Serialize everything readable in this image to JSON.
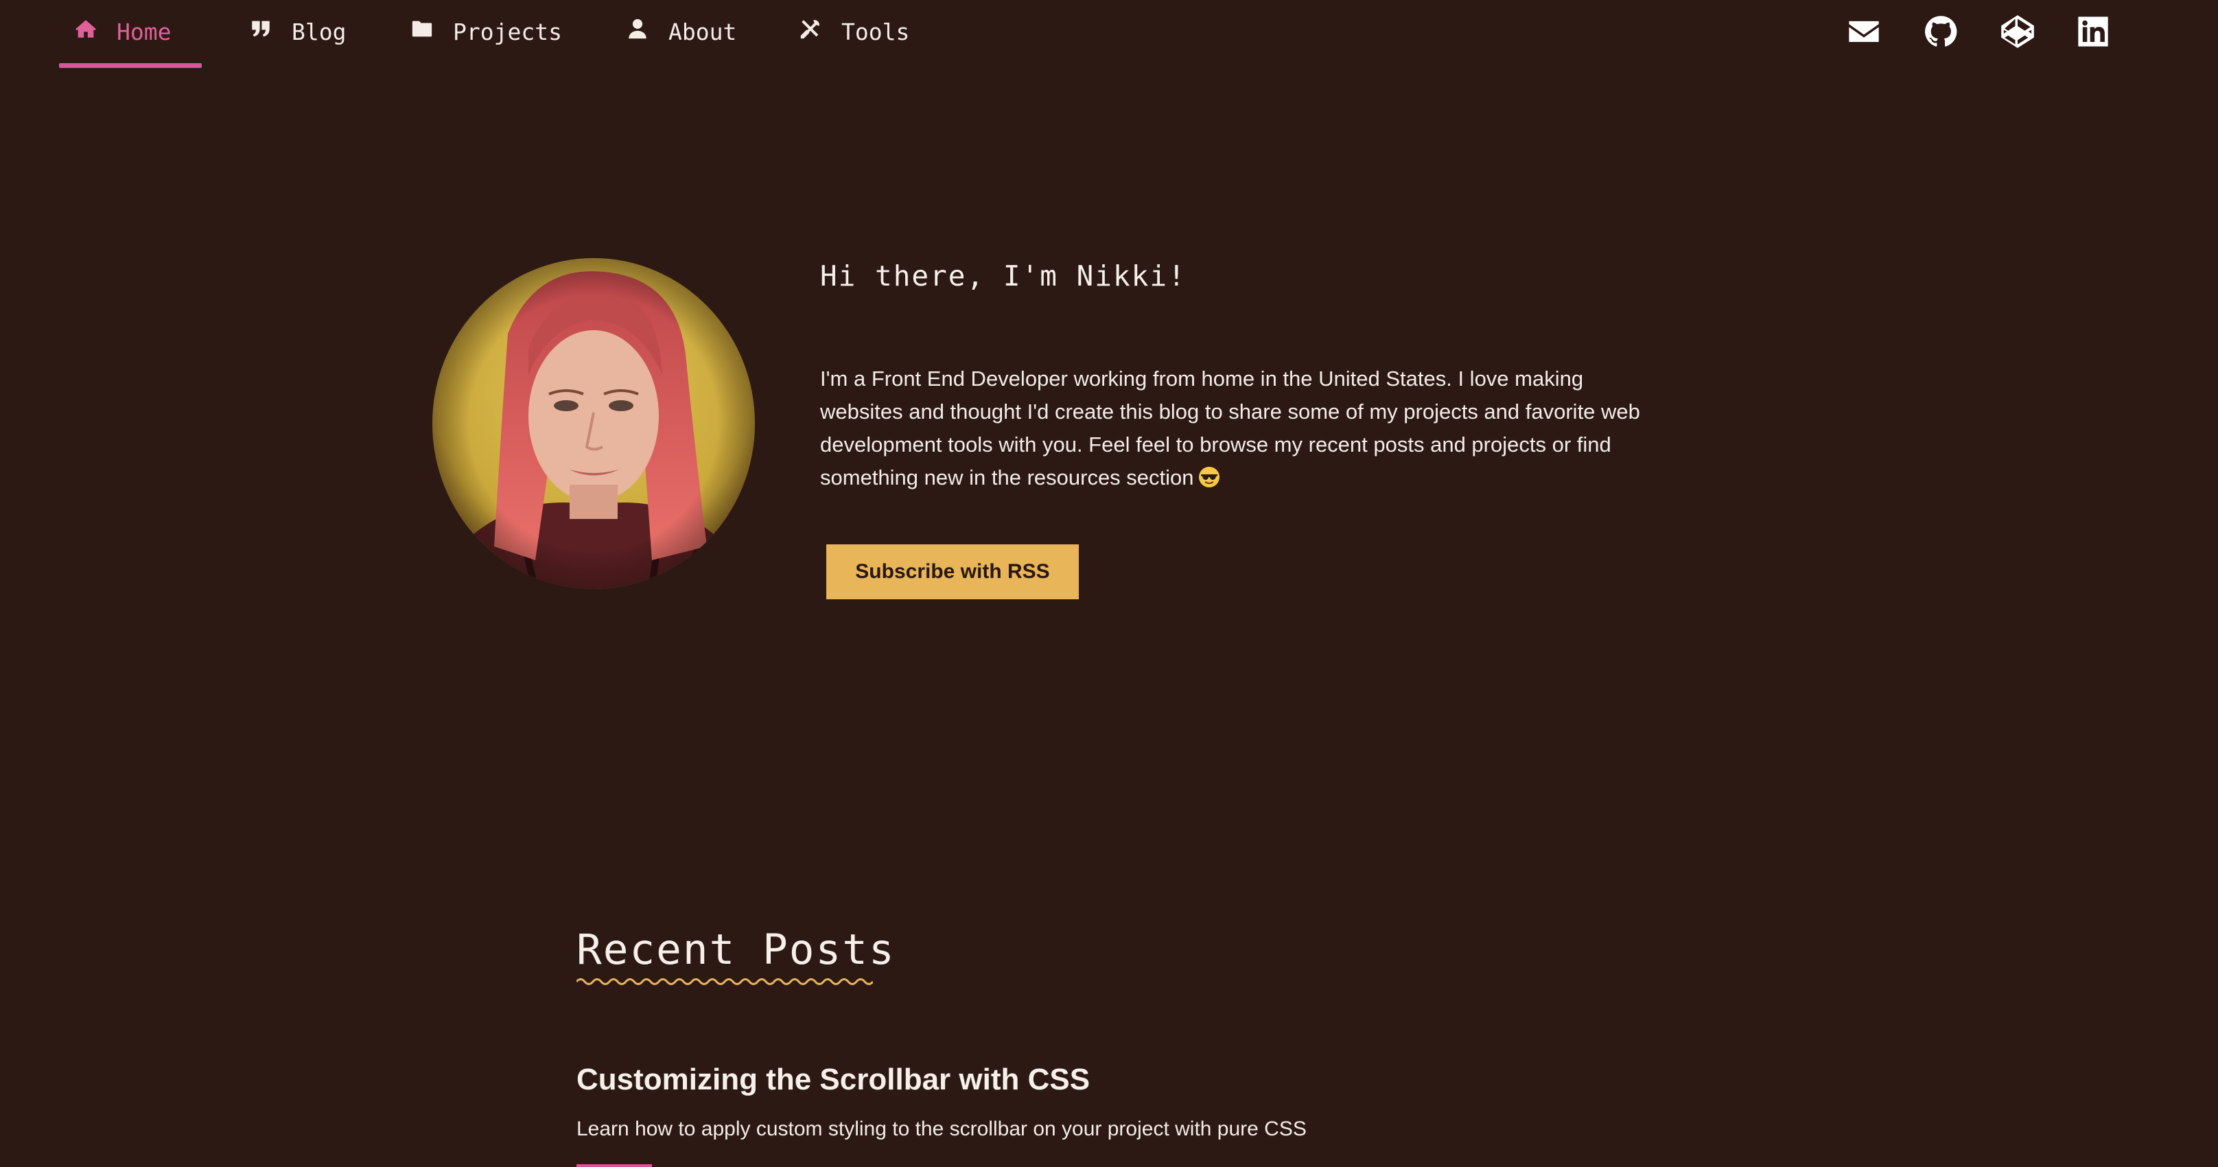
{
  "nav": {
    "items": [
      {
        "label": "Home",
        "icon": "home-icon",
        "active": true
      },
      {
        "label": "Blog",
        "icon": "quote-icon",
        "active": false
      },
      {
        "label": "Projects",
        "icon": "folder-icon",
        "active": false
      },
      {
        "label": "About",
        "icon": "user-icon",
        "active": false
      },
      {
        "label": "Tools",
        "icon": "tools-icon",
        "active": false
      }
    ],
    "social": [
      "email-icon",
      "github-icon",
      "codepen-icon",
      "linkedin-icon"
    ]
  },
  "hero": {
    "title": "Hi there, I'm Nikki!",
    "text": "I'm a Front End Developer working from home in the United States. I love making websites and thought I'd create this blog to share some of my projects and favorite web development tools with you. Feel feel to browse my recent posts and projects or find something new in the resources section",
    "emoji": "smiling-face-with-sunglasses",
    "button_label": "Subscribe with RSS"
  },
  "recent_posts": {
    "heading": "Recent Posts",
    "posts": [
      {
        "title": "Customizing the Scrollbar with CSS",
        "description": "Learn how to apply custom styling to the scrollbar on your project with pure CSS"
      }
    ]
  },
  "colors": {
    "background": "#2c1914",
    "accent_pink": "#e0619a",
    "accent_yellow": "#e8b558",
    "text": "#f4ece6"
  }
}
